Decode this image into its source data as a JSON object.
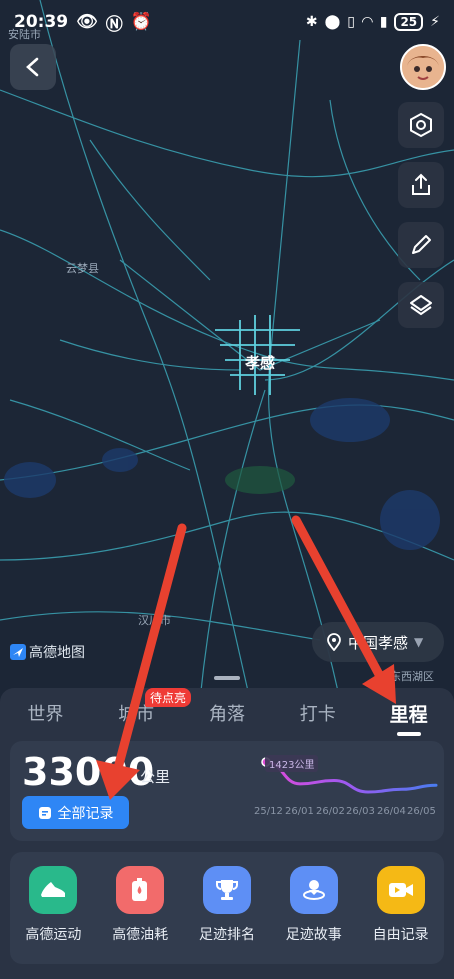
{
  "status_bar": {
    "time": "20:39",
    "battery": "25"
  },
  "map": {
    "labels": [
      "安陆市",
      "云梦县",
      "孝感",
      "汉川市",
      "东西湖区"
    ],
    "logo_text": "高德地图",
    "location_text": "中国孝感"
  },
  "tabs": [
    {
      "label": "世界",
      "active": false
    },
    {
      "label": "城市",
      "active": false
    },
    {
      "label": "角落",
      "active": false
    },
    {
      "label": "打卡",
      "active": false
    },
    {
      "label": "里程",
      "active": true
    }
  ],
  "city_badge": "待点亮",
  "mileage": {
    "value": "33000",
    "unit": "公里",
    "all_records_label": "全部记录",
    "peak_label": "1423公里",
    "months": [
      "25/12",
      "26/01",
      "26/02",
      "26/03",
      "26/04",
      "26/05"
    ],
    "trend": [
      1423,
      1100,
      1150,
      980,
      1020,
      1080
    ]
  },
  "apps": [
    {
      "label": "高德运动",
      "icon": "running-shoe-icon",
      "color": "#29b98b"
    },
    {
      "label": "高德油耗",
      "icon": "fuel-icon",
      "color": "#f26b6b"
    },
    {
      "label": "足迹排名",
      "icon": "trophy-icon",
      "color": "#5e8ff5"
    },
    {
      "label": "足迹故事",
      "icon": "story-icon",
      "color": "#5e8ff5"
    },
    {
      "label": "自由记录",
      "icon": "video-camera-icon",
      "color": "#f5b915"
    }
  ],
  "colors": {
    "accent": "#2e86f5",
    "arrow": "#e8412f",
    "badge": "#ef3b36"
  }
}
